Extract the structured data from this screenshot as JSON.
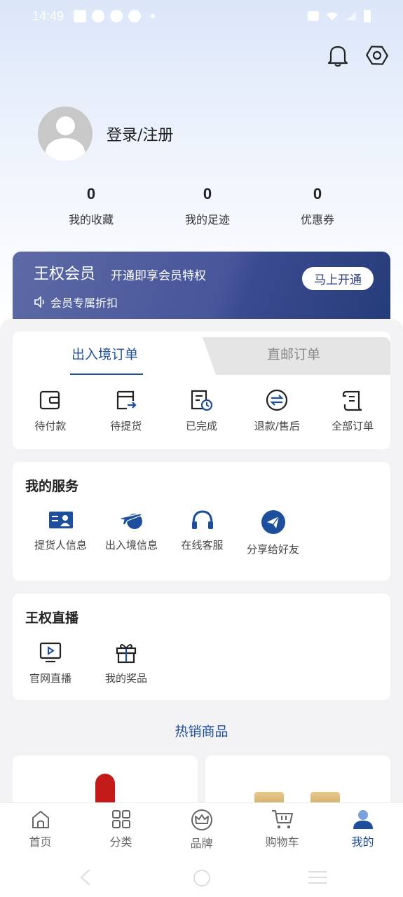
{
  "status_bar": {
    "time": "14:49"
  },
  "header": {
    "bell_icon": "bell-icon",
    "settings_icon": "hexagon-settings-icon"
  },
  "profile": {
    "login_label": "登录/注册"
  },
  "stats": [
    {
      "value": "0",
      "label": "我的收藏"
    },
    {
      "value": "0",
      "label": "我的足迹"
    },
    {
      "value": "0",
      "label": "优惠券"
    }
  ],
  "vip": {
    "title": "王权会员",
    "subtitle": "开通即享会员特权",
    "tag": "会员专属折扣",
    "button": "马上开通"
  },
  "orders": {
    "tabs": [
      "出入境订单",
      "直邮订单"
    ],
    "items": [
      {
        "label": "待付款",
        "icon": "wallet-icon"
      },
      {
        "label": "待提货",
        "icon": "pickup-icon"
      },
      {
        "label": "已完成",
        "icon": "completed-icon"
      },
      {
        "label": "退款/售后",
        "icon": "refund-icon"
      },
      {
        "label": "全部订单",
        "icon": "all-orders-icon"
      }
    ]
  },
  "services": {
    "title": "我的服务",
    "items": [
      {
        "label": "提货人信息",
        "icon": "id-card-icon"
      },
      {
        "label": "出入境信息",
        "icon": "airplane-icon"
      },
      {
        "label": "在线客服",
        "icon": "headset-icon"
      },
      {
        "label": "分享给好友",
        "icon": "share-icon"
      }
    ]
  },
  "live": {
    "title": "王权直播",
    "items": [
      {
        "label": "官网直播",
        "icon": "tv-play-icon"
      },
      {
        "label": "我的奖品",
        "icon": "gift-icon"
      }
    ]
  },
  "hot": {
    "title": "热销商品"
  },
  "bottom_nav": [
    {
      "label": "首页",
      "icon": "home-icon"
    },
    {
      "label": "分类",
      "icon": "category-icon"
    },
    {
      "label": "品牌",
      "icon": "crown-icon"
    },
    {
      "label": "购物车",
      "icon": "cart-icon"
    },
    {
      "label": "我的",
      "icon": "user-icon",
      "active": true
    }
  ],
  "colors": {
    "accent": "#1e4f9c",
    "vip_start": "#5d6aa6",
    "vip_end": "#263c7a"
  }
}
